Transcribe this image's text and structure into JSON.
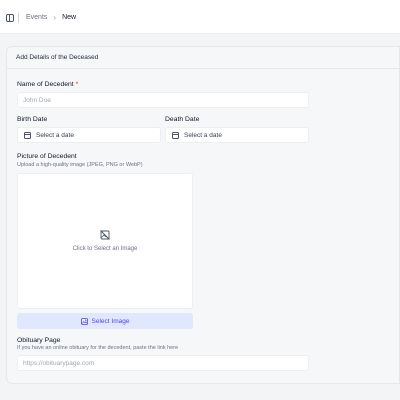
{
  "header": {
    "breadcrumb": {
      "parent": "Events",
      "separator": "›",
      "current": "New"
    }
  },
  "form": {
    "section_title": "Add Details of the Deceased",
    "name": {
      "label": "Name of Decedent",
      "required_mark": "*",
      "placeholder": "John Doe"
    },
    "birth_date": {
      "label": "Birth Date",
      "button_text": "Select a date"
    },
    "death_date": {
      "label": "Death Date",
      "button_text": "Select a date"
    },
    "picture": {
      "label": "Picture of Decedent",
      "help": "Upload a high-quality image (JPEG, PNG or WebP)",
      "dropzone_text": "Click to Select an Image",
      "button_text": "Select Image"
    },
    "obituary": {
      "label": "Obituary Page",
      "help": "If you have an online obituary for the decedent, paste the link here",
      "placeholder": "https://obituarypage.com"
    }
  },
  "colors": {
    "accent": "#4f46e5",
    "accent_bg": "#e0e7ff",
    "required": "#dc2626",
    "background": "#f3f4f6"
  },
  "icons": [
    "sidebar-toggle-icon",
    "calendar-icon",
    "image-placeholder-icon",
    "image-icon"
  ]
}
